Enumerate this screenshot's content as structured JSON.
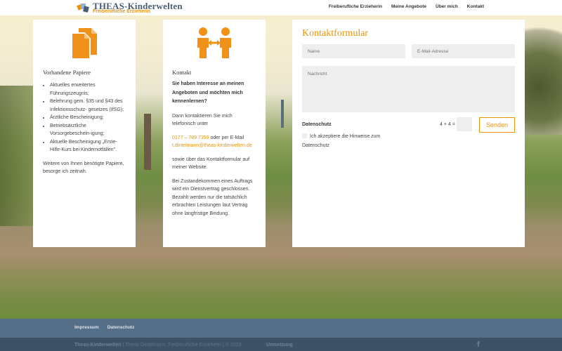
{
  "header": {
    "logo_title": "THEAS-Kinderwelten",
    "logo_subtitle": "Freiberufliche Erzieherin",
    "nav": [
      "Freiberufliche Erzieherin",
      "Meine Angebote",
      "Über mich",
      "Kontakt"
    ]
  },
  "papers": {
    "icon": "documents-icon",
    "heading": "Vorhandene Papiere",
    "items": [
      "Aktuelles erweitertes Führungszeugnis;",
      "Belehrung gem. §35 und §43 des Infektionsschutz- gesetzes (IfSG);",
      "Ärztliche Bescheinigung;",
      "Betriebsärztliche Vorsorgebeschein-igung;",
      "Aktuelle Bescheinigung „Erste-Hilfe-Kurs bei Kindernotfällen\"."
    ],
    "note": "Weitere von Ihnen benötigte Papiere, besorge ich zeitnah."
  },
  "contact": {
    "icon": "people-exchange-icon",
    "heading": "Kontakt",
    "lead": "Sie haben Interesse an meinen Angeboten und möchten mich kennenlernen?",
    "intro": "Dann kontaktieren Sie mich telefonisch unter",
    "phone": "0177 – 789 7359",
    "email_prefix": " oder per E-Mail",
    "email": "t.dintelmann@theas-kinderwelten.de",
    "form_note": "sowie über das Kontaktformular auf meiner Website.",
    "contract_note": "Bei Zustandekommen eines Auftrags wird ein Dienstvertrag geschlossen. Bezahlt werden nur die tatsächlich erbrachten Leistungen laut Vertrag ohne langfristige Bindung."
  },
  "form": {
    "title": "Kontaktformular",
    "name_placeholder": "Name",
    "email_placeholder": "E-Mail-Adresse",
    "message_placeholder": "Nachricht",
    "datenschutz_label": "Datenschutz",
    "captcha": "4 + 4 =",
    "send_label": "Senden",
    "consent_label": "Ich akzeptiere die Hinweise zum Datenschutz"
  },
  "footer": {
    "links": [
      "Impressum",
      "Datenschutz"
    ],
    "brand": "Theas-Kinderwelten",
    "copyright": " | Theda Dintelmann, Freiberufliche Erzieherin | © 2023",
    "umsetzung": "Umsetzung",
    "social_icon": "facebook-icon",
    "social_glyph": "f"
  },
  "colors": {
    "accent": "#e8940a",
    "brand_blue": "#4a5d74",
    "footer_top": "#566f88",
    "footer_bottom": "#3d5266"
  }
}
